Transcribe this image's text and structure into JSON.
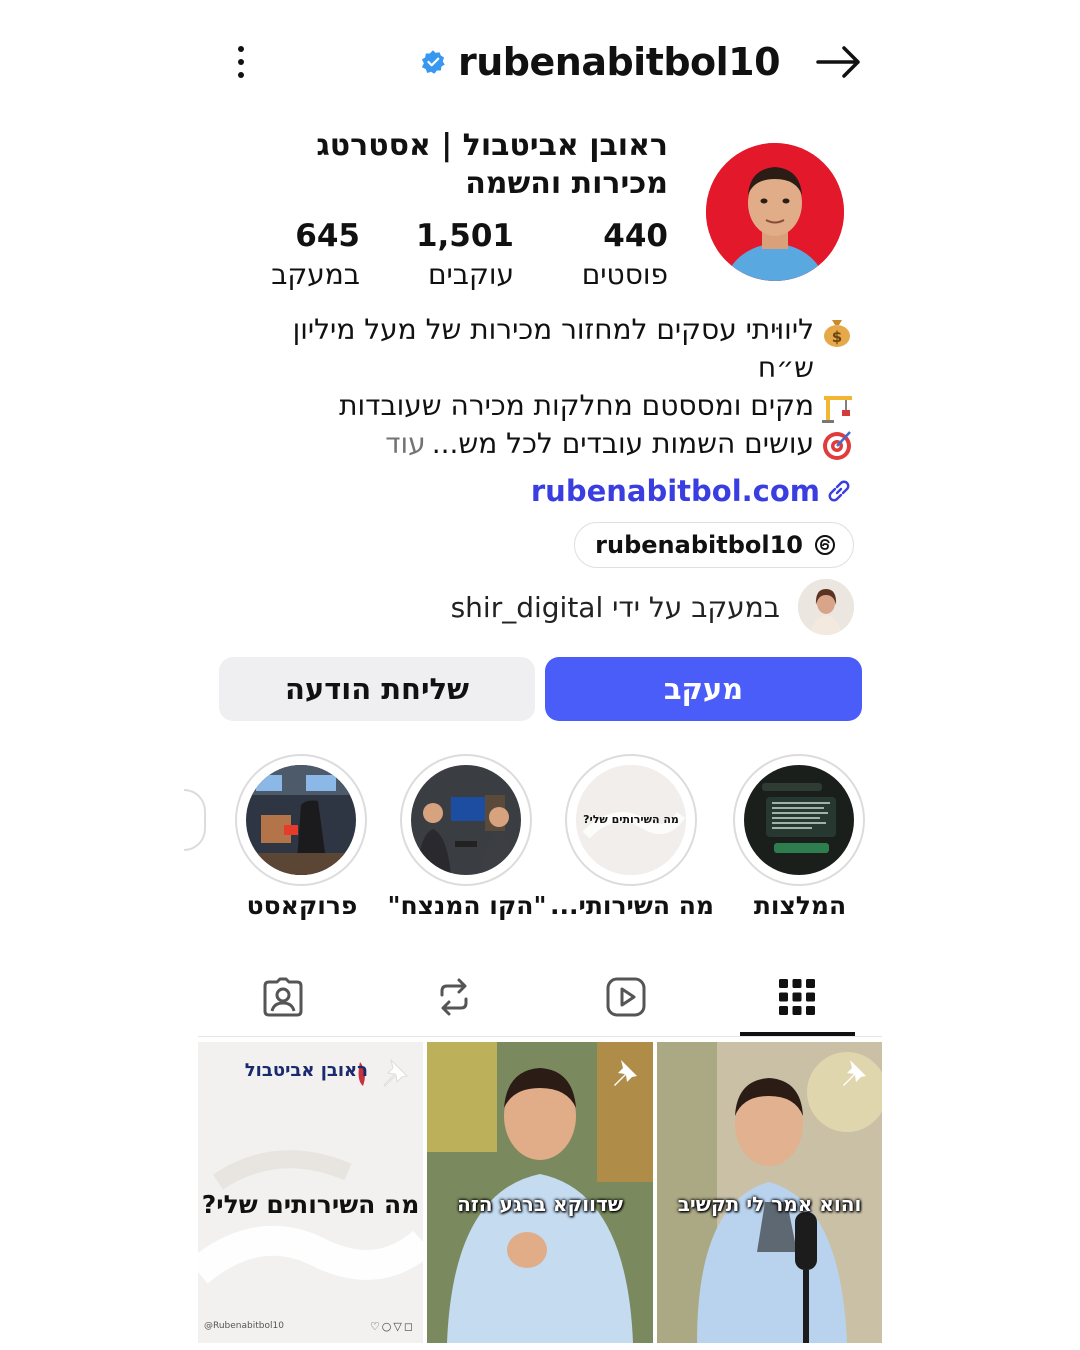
{
  "header": {
    "username": "rubenabitbol10",
    "verified": true,
    "accent_color": "#3897f0"
  },
  "profile": {
    "display_name": "ראובן אביטבול | אסטרטג מכירות והשמה",
    "stats": {
      "posts": {
        "value": "440",
        "label": "פוסטים"
      },
      "followers": {
        "value": "1,501",
        "label": "עוקבים"
      },
      "following": {
        "value": "645",
        "label": "במעקב"
      }
    },
    "bio": {
      "line1_icon": "money-bag-icon",
      "line1": "ליווּיתי עסקים למחזור מכירות של מעל מיליון ש״ח",
      "line2_icon": "crane-icon",
      "line2": "מקים ומססטם מחלקות מכירה שעובדות",
      "line3_icon": "target-icon",
      "line3": "עושים השמות עובדים לכל מש...",
      "more": "עוד"
    },
    "link": "rubenabitbol.com",
    "threads_handle": "rubenabitbol10",
    "followed_by": "במעקב על ידי shir_digital"
  },
  "actions": {
    "follow_label": "מעקב",
    "message_label": "שליחת הודעה",
    "follow_color": "#4a5df9"
  },
  "highlights": [
    {
      "label": "המלצות"
    },
    {
      "label": "מה השירותי...",
      "cover_text": "מה השירותים שלי?"
    },
    {
      "label": "\"הקו המנצח\""
    },
    {
      "label": "פרוקאסט"
    }
  ],
  "tabs": [
    "grid",
    "reels",
    "reposts",
    "tagged"
  ],
  "posts": [
    {
      "caption": "והוא אמר לי תקשיב",
      "pinned": true
    },
    {
      "caption": "שדווקא ברגע הזה",
      "pinned": true
    },
    {
      "title": "מה השירותים שלי?",
      "brand": "ראובן אביטבול",
      "handle": "@Rubenabitbol10",
      "pinned": true
    }
  ]
}
